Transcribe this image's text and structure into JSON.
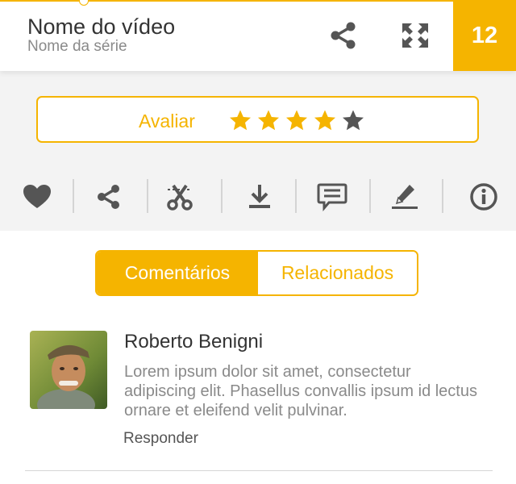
{
  "header": {
    "title": "Nome do vídeo",
    "subtitle": "Nome da série",
    "counter": "12",
    "share_icon": "share-icon",
    "expand_icon": "fullscreen-icon"
  },
  "rating": {
    "label": "Avaliar",
    "stars_filled": 4,
    "stars_total": 5
  },
  "actions": [
    {
      "icon": "heart-icon"
    },
    {
      "icon": "share-icon"
    },
    {
      "icon": "scissors-icon"
    },
    {
      "icon": "download-icon"
    },
    {
      "icon": "comment-icon"
    },
    {
      "icon": "edit-icon"
    },
    {
      "icon": "info-icon"
    }
  ],
  "tabs": [
    {
      "label": "Comentários",
      "active": true
    },
    {
      "label": "Relacionados",
      "active": false
    }
  ],
  "comment": {
    "author": "Roberto Benigni",
    "text": "Lorem ipsum dolor sit amet, consectetur adipiscing elit. Phasellus convallis ipsum id lectus ornare et eleifend velit pulvinar.",
    "reply_label": "Responder"
  },
  "colors": {
    "accent": "#f5b400",
    "panel_bg": "#f3f3f3",
    "icon_gray": "#555555",
    "text_dark": "#333333",
    "text_muted": "#8a8a8a"
  }
}
